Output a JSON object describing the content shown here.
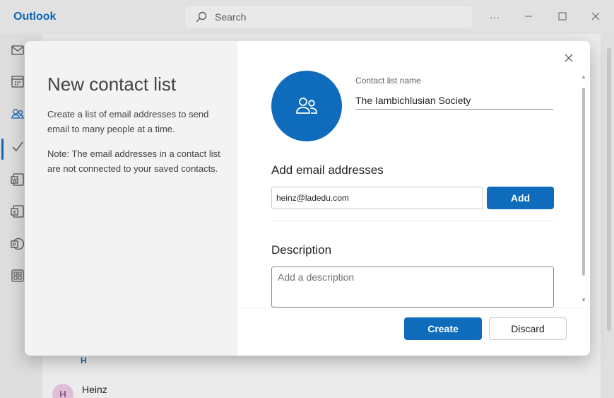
{
  "app": {
    "title": "Outlook",
    "search_placeholder": "Search"
  },
  "background": {
    "section_letter": "H",
    "contact_initial": "H",
    "contact_name": "Heinz"
  },
  "dialog": {
    "title": "New contact list",
    "description": "Create a list of email addresses to send email to many people at a time.",
    "note": "Note: The email addresses in a contact list are not connected to your saved contacts.",
    "name_label": "Contact list name",
    "name_value": "The Iambichlusian Society",
    "add_email_heading": "Add email addresses",
    "email_value": "heinz@ladedu.com",
    "add_label": "Add",
    "description_heading": "Description",
    "description_placeholder": "Add a description",
    "create_label": "Create",
    "discard_label": "Discard"
  },
  "colors": {
    "accent": "#0f6cbd"
  }
}
